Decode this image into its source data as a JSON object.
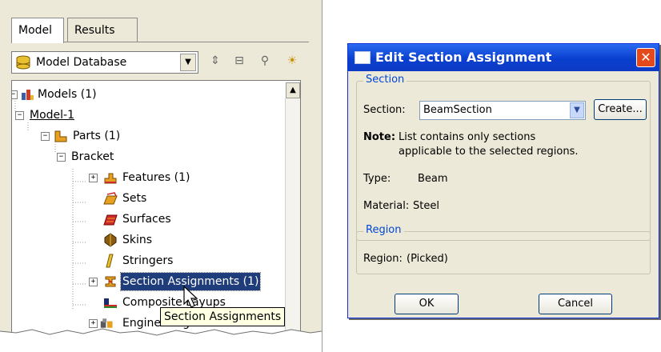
{
  "tabs": {
    "model": "Model",
    "results": "Results"
  },
  "toolbar": {
    "database_label": "Model Database"
  },
  "tree": {
    "models": "Models (1)",
    "model1": "Model-1",
    "parts": "Parts (1)",
    "bracket": "Bracket",
    "features": "Features (1)",
    "sets": "Sets",
    "surfaces": "Surfaces",
    "skins": "Skins",
    "stringers": "Stringers",
    "section_assignments": "Section Assignments (1)",
    "composite_layups": "Composite Layups",
    "engineering_features": "Engineering Features"
  },
  "tooltip": "Section Assignments",
  "dialog": {
    "title": "Edit Section Assignment",
    "section_group": "Section",
    "section_label": "Section:",
    "section_value": "BeamSection",
    "create_button": "Create...",
    "note_label": "Note:",
    "note_line1": "List contains only sections",
    "note_line2": "applicable to the selected regions.",
    "type_label": "Type:",
    "type_value": "Beam",
    "material_label": "Material:",
    "material_value": "Steel",
    "region_group": "Region",
    "region_label": "Region:",
    "region_value": "(Picked)",
    "ok_button": "OK",
    "cancel_button": "Cancel"
  },
  "colors": {
    "title_bar": "#0a3fcf",
    "selection": "#1f3d7a",
    "tooltip_bg": "#ffffe1",
    "group_title": "#0046d5"
  }
}
